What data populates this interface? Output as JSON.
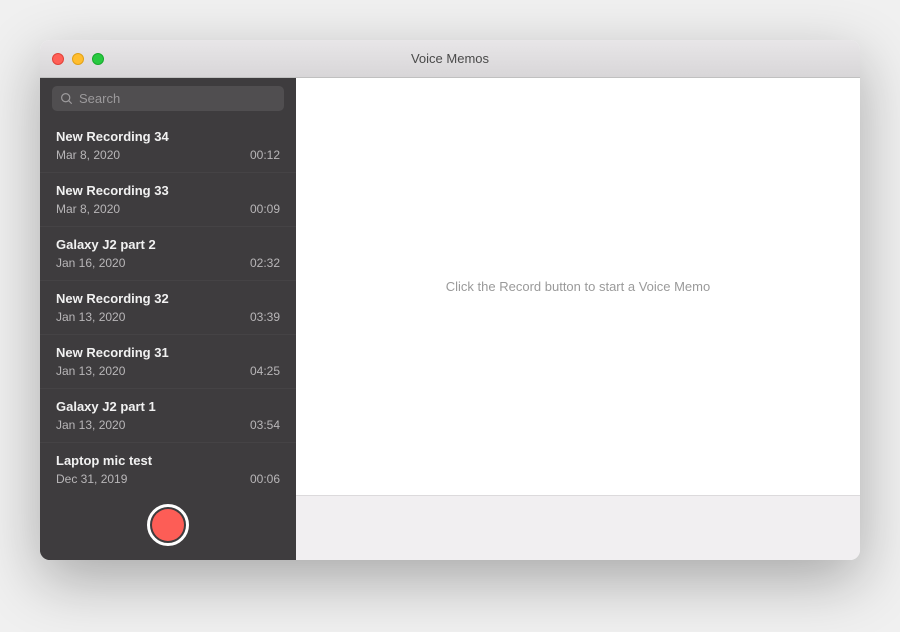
{
  "window": {
    "title": "Voice Memos"
  },
  "search": {
    "placeholder": "Search"
  },
  "recordings": [
    {
      "title": "New Recording 34",
      "date": "Mar 8, 2020",
      "duration": "00:12"
    },
    {
      "title": "New Recording 33",
      "date": "Mar 8, 2020",
      "duration": "00:09"
    },
    {
      "title": "Galaxy J2 part 2",
      "date": "Jan 16, 2020",
      "duration": "02:32"
    },
    {
      "title": "New Recording 32",
      "date": "Jan 13, 2020",
      "duration": "03:39"
    },
    {
      "title": "New Recording 31",
      "date": "Jan 13, 2020",
      "duration": "04:25"
    },
    {
      "title": "Galaxy J2 part 1",
      "date": "Jan 13, 2020",
      "duration": "03:54"
    },
    {
      "title": "Laptop mic test",
      "date": "Dec 31, 2019",
      "duration": "00:06"
    }
  ],
  "main": {
    "empty_message": "Click the Record button to start a Voice Memo"
  }
}
